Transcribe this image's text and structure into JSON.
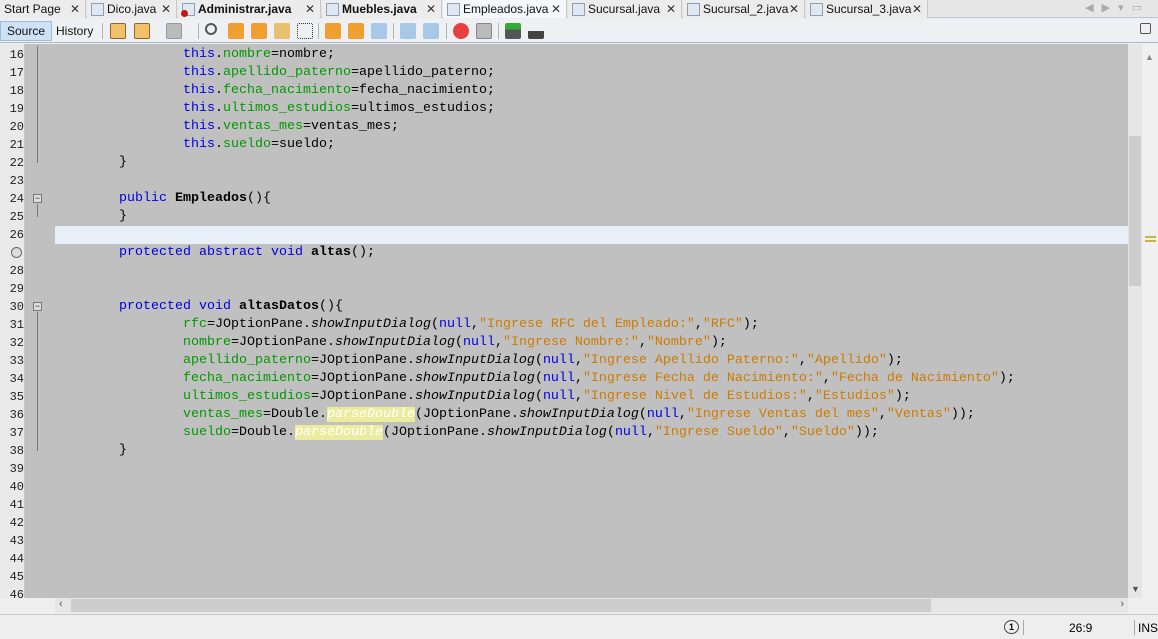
{
  "tabs": [
    {
      "label": "Start Page",
      "bold": false,
      "icon": "none"
    },
    {
      "label": "Dico.java",
      "bold": false,
      "icon": "java-run-icon"
    },
    {
      "label": "Administrar.java",
      "bold": true,
      "icon": "java-error-icon"
    },
    {
      "label": "Muebles.java",
      "bold": true,
      "icon": "java-file-icon"
    },
    {
      "label": "Empleados.java",
      "bold": false,
      "icon": "java-file-icon",
      "active": true
    },
    {
      "label": "Sucursal.java",
      "bold": false,
      "icon": "java-file-icon"
    },
    {
      "label": "Sucursal_2.java",
      "bold": false,
      "icon": "java-file-icon"
    },
    {
      "label": "Sucursal_3.java",
      "bold": false,
      "icon": "java-file-icon"
    }
  ],
  "toolbar": {
    "source_label": "Source",
    "history_label": "History"
  },
  "colors": {
    "keyword": "#0000e6",
    "field": "#009900",
    "string": "#ce7b00",
    "editor_bg": "#c0c0c0",
    "current_line": "#e9eff8"
  },
  "code": [
    {
      "n": "16",
      "t": [
        [
          "p",
          "                "
        ],
        [
          "kw",
          "this"
        ],
        [
          "p",
          "."
        ],
        [
          "fld",
          "nombre"
        ],
        [
          "p",
          "=nombre;"
        ]
      ]
    },
    {
      "n": "17",
      "t": [
        [
          "p",
          "                "
        ],
        [
          "kw",
          "this"
        ],
        [
          "p",
          "."
        ],
        [
          "fld",
          "apellido_paterno"
        ],
        [
          "p",
          "=apellido_paterno;"
        ]
      ]
    },
    {
      "n": "18",
      "t": [
        [
          "p",
          "                "
        ],
        [
          "kw",
          "this"
        ],
        [
          "p",
          "."
        ],
        [
          "fld",
          "fecha_nacimiento"
        ],
        [
          "p",
          "=fecha_nacimiento;"
        ]
      ]
    },
    {
      "n": "19",
      "t": [
        [
          "p",
          "                "
        ],
        [
          "kw",
          "this"
        ],
        [
          "p",
          "."
        ],
        [
          "fld",
          "ultimos_estudios"
        ],
        [
          "p",
          "=ultimos_estudios;"
        ]
      ]
    },
    {
      "n": "20",
      "t": [
        [
          "p",
          "                "
        ],
        [
          "kw",
          "this"
        ],
        [
          "p",
          "."
        ],
        [
          "fld",
          "ventas_mes"
        ],
        [
          "p",
          "=ventas_mes;"
        ]
      ]
    },
    {
      "n": "21",
      "t": [
        [
          "p",
          "                "
        ],
        [
          "kw",
          "this"
        ],
        [
          "p",
          "."
        ],
        [
          "fld",
          "sueldo"
        ],
        [
          "p",
          "=sueldo;"
        ]
      ]
    },
    {
      "n": "22",
      "t": [
        [
          "p",
          "        }"
        ]
      ]
    },
    {
      "n": "23",
      "t": []
    },
    {
      "n": "24",
      "t": [
        [
          "p",
          "        "
        ],
        [
          "kw",
          "public"
        ],
        [
          "p",
          " "
        ],
        [
          "bd",
          "Empleados"
        ],
        [
          "p",
          "(){"
        ]
      ]
    },
    {
      "n": "25",
      "t": [
        [
          "p",
          "        }"
        ]
      ]
    },
    {
      "n": "26",
      "t": [],
      "current": true
    },
    {
      "n": "",
      "t": [
        [
          "p",
          "        "
        ],
        [
          "kw",
          "protected abstract void"
        ],
        [
          "p",
          " "
        ],
        [
          "bd",
          "altas"
        ],
        [
          "p",
          "();"
        ]
      ],
      "icon": "implements-icon"
    },
    {
      "n": "28",
      "t": []
    },
    {
      "n": "29",
      "t": []
    },
    {
      "n": "30",
      "t": [
        [
          "p",
          "        "
        ],
        [
          "kw",
          "protected void"
        ],
        [
          "p",
          " "
        ],
        [
          "bd",
          "altasDatos"
        ],
        [
          "p",
          "(){"
        ]
      ]
    },
    {
      "n": "31",
      "t": [
        [
          "p",
          "                "
        ],
        [
          "fld",
          "rfc"
        ],
        [
          "p",
          "=JOptionPane."
        ],
        [
          "it",
          "showInputDialog"
        ],
        [
          "p",
          "("
        ],
        [
          "kw",
          "null"
        ],
        [
          "p",
          ","
        ],
        [
          "str",
          "\"Ingrese RFC del Empleado:\""
        ],
        [
          "p",
          ","
        ],
        [
          "str",
          "\"RFC\""
        ],
        [
          "p",
          ");"
        ]
      ]
    },
    {
      "n": "32",
      "t": [
        [
          "p",
          "                "
        ],
        [
          "fld",
          "nombre"
        ],
        [
          "p",
          "=JOptionPane."
        ],
        [
          "it",
          "showInputDialog"
        ],
        [
          "p",
          "("
        ],
        [
          "kw",
          "null"
        ],
        [
          "p",
          ","
        ],
        [
          "str",
          "\"Ingrese Nombre:\""
        ],
        [
          "p",
          ","
        ],
        [
          "str",
          "\"Nombre\""
        ],
        [
          "p",
          ");"
        ]
      ]
    },
    {
      "n": "33",
      "t": [
        [
          "p",
          "                "
        ],
        [
          "fld",
          "apellido_paterno"
        ],
        [
          "p",
          "=JOptionPane."
        ],
        [
          "it",
          "showInputDialog"
        ],
        [
          "p",
          "("
        ],
        [
          "kw",
          "null"
        ],
        [
          "p",
          ","
        ],
        [
          "str",
          "\"Ingrese Apellido Paterno:\""
        ],
        [
          "p",
          ","
        ],
        [
          "str",
          "\"Apellido\""
        ],
        [
          "p",
          ");"
        ]
      ]
    },
    {
      "n": "34",
      "t": [
        [
          "p",
          "                "
        ],
        [
          "fld",
          "fecha_nacimiento"
        ],
        [
          "p",
          "=JOptionPane."
        ],
        [
          "it",
          "showInputDialog"
        ],
        [
          "p",
          "("
        ],
        [
          "kw",
          "null"
        ],
        [
          "p",
          ","
        ],
        [
          "str",
          "\"Ingrese Fecha de Nacimiento:\""
        ],
        [
          "p",
          ","
        ],
        [
          "str",
          "\"Fecha de Nacimiento\""
        ],
        [
          "p",
          ");"
        ]
      ]
    },
    {
      "n": "35",
      "t": [
        [
          "p",
          "                "
        ],
        [
          "fld",
          "ultimos_estudios"
        ],
        [
          "p",
          "=JOptionPane."
        ],
        [
          "it",
          "showInputDialog"
        ],
        [
          "p",
          "("
        ],
        [
          "kw",
          "null"
        ],
        [
          "p",
          ","
        ],
        [
          "str",
          "\"Ingrese Nivel de Estudios:\""
        ],
        [
          "p",
          ","
        ],
        [
          "str",
          "\"Estudios\""
        ],
        [
          "p",
          ");"
        ]
      ]
    },
    {
      "n": "36",
      "t": [
        [
          "p",
          "                "
        ],
        [
          "fld",
          "ventas_mes"
        ],
        [
          "p",
          "=Double."
        ],
        [
          "hl",
          "parseDouble"
        ],
        [
          "p",
          "(JOptionPane."
        ],
        [
          "it",
          "showInputDialog"
        ],
        [
          "p",
          "("
        ],
        [
          "kw",
          "null"
        ],
        [
          "p",
          ","
        ],
        [
          "str",
          "\"Ingrese Ventas del mes\""
        ],
        [
          "p",
          ","
        ],
        [
          "str",
          "\"Ventas\""
        ],
        [
          "p",
          "));"
        ]
      ]
    },
    {
      "n": "37",
      "t": [
        [
          "p",
          "                "
        ],
        [
          "fld",
          "sueldo"
        ],
        [
          "p",
          "=Double."
        ],
        [
          "hl",
          "parseDouble"
        ],
        [
          "p",
          "(JOptionPane."
        ],
        [
          "it",
          "showInputDialog"
        ],
        [
          "p",
          "("
        ],
        [
          "kw",
          "null"
        ],
        [
          "p",
          ","
        ],
        [
          "str",
          "\"Ingrese Sueldo\""
        ],
        [
          "p",
          ","
        ],
        [
          "str",
          "\"Sueldo\""
        ],
        [
          "p",
          "));"
        ]
      ]
    },
    {
      "n": "38",
      "t": [
        [
          "p",
          "        }"
        ]
      ]
    },
    {
      "n": "39",
      "t": []
    },
    {
      "n": "40",
      "t": []
    },
    {
      "n": "41",
      "t": []
    },
    {
      "n": "42",
      "t": []
    },
    {
      "n": "43",
      "t": []
    },
    {
      "n": "44",
      "t": []
    },
    {
      "n": "45",
      "t": []
    },
    {
      "n": "46",
      "t": []
    }
  ],
  "status": {
    "notifications": "1",
    "position": "26:9",
    "mode": "INS"
  }
}
